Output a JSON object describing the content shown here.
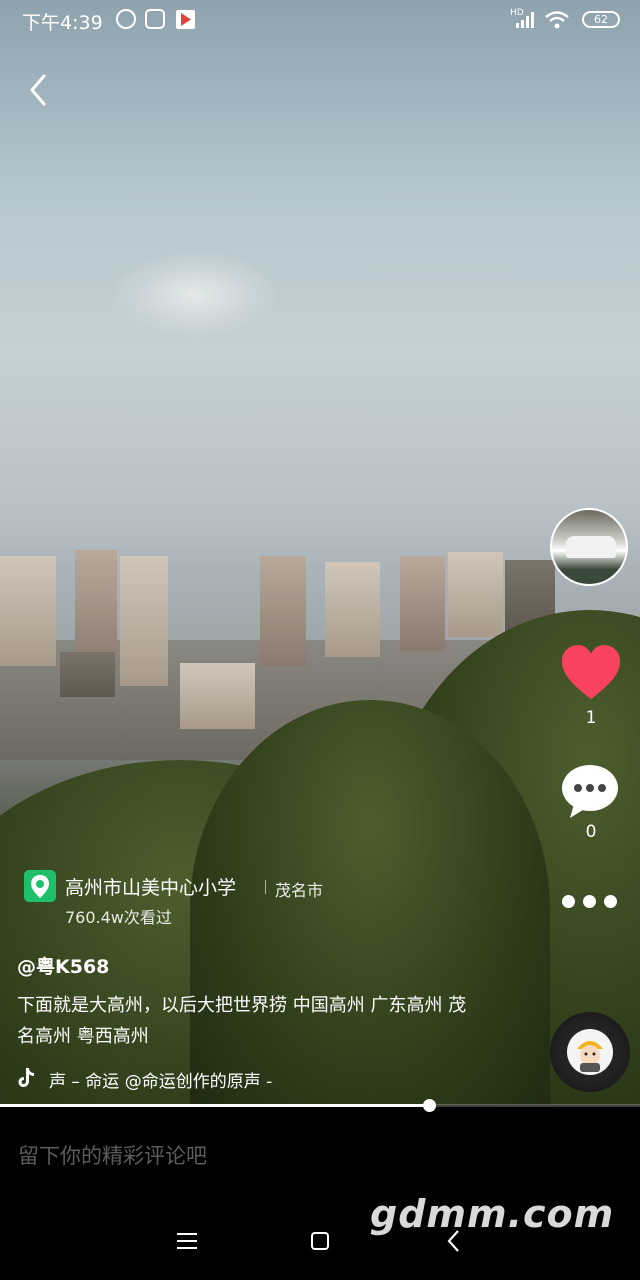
{
  "status_bar": {
    "time": "下午4:39",
    "battery": "62",
    "network": "HD"
  },
  "video": {
    "location": {
      "name": "高州市山美中心小学",
      "city": "茂名市",
      "views": "760.4w次看过"
    },
    "author": "@粤K568",
    "caption": "下面就是大高州，以后大把世界捞   中国高州   广东高州   茂名高州   粤西高州",
    "music": "声 – 命运    @命运创作的原声 -",
    "progress": 0.67
  },
  "actions": {
    "like_count": "1",
    "comment_count": "0"
  },
  "comment_box": {
    "placeholder": "留下你的精彩评论吧"
  },
  "watermark": "gdmm.com",
  "colors": {
    "location_pin": "#1fc06a",
    "like": "#f9435e"
  },
  "icons": {
    "back": "chevron-left-icon",
    "like": "heart-icon",
    "comment": "comment-bubble-icon",
    "more": "more-dots-icon",
    "music": "tiktok-note-icon",
    "location": "location-pin-icon"
  }
}
